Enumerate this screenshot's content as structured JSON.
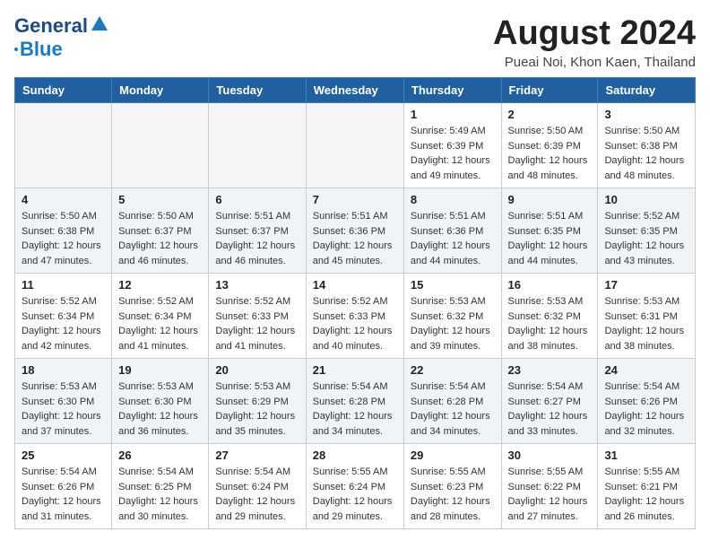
{
  "header": {
    "logo_line1": "General",
    "logo_line2": "Blue",
    "main_title": "August 2024",
    "subtitle": "Pueai Noi, Khon Kaen, Thailand"
  },
  "days_of_week": [
    "Sunday",
    "Monday",
    "Tuesday",
    "Wednesday",
    "Thursday",
    "Friday",
    "Saturday"
  ],
  "weeks": [
    [
      {
        "day": "",
        "info": ""
      },
      {
        "day": "",
        "info": ""
      },
      {
        "day": "",
        "info": ""
      },
      {
        "day": "",
        "info": ""
      },
      {
        "day": "1",
        "info": "Sunrise: 5:49 AM\nSunset: 6:39 PM\nDaylight: 12 hours\nand 49 minutes."
      },
      {
        "day": "2",
        "info": "Sunrise: 5:50 AM\nSunset: 6:39 PM\nDaylight: 12 hours\nand 48 minutes."
      },
      {
        "day": "3",
        "info": "Sunrise: 5:50 AM\nSunset: 6:38 PM\nDaylight: 12 hours\nand 48 minutes."
      }
    ],
    [
      {
        "day": "4",
        "info": "Sunrise: 5:50 AM\nSunset: 6:38 PM\nDaylight: 12 hours\nand 47 minutes."
      },
      {
        "day": "5",
        "info": "Sunrise: 5:50 AM\nSunset: 6:37 PM\nDaylight: 12 hours\nand 46 minutes."
      },
      {
        "day": "6",
        "info": "Sunrise: 5:51 AM\nSunset: 6:37 PM\nDaylight: 12 hours\nand 46 minutes."
      },
      {
        "day": "7",
        "info": "Sunrise: 5:51 AM\nSunset: 6:36 PM\nDaylight: 12 hours\nand 45 minutes."
      },
      {
        "day": "8",
        "info": "Sunrise: 5:51 AM\nSunset: 6:36 PM\nDaylight: 12 hours\nand 44 minutes."
      },
      {
        "day": "9",
        "info": "Sunrise: 5:51 AM\nSunset: 6:35 PM\nDaylight: 12 hours\nand 44 minutes."
      },
      {
        "day": "10",
        "info": "Sunrise: 5:52 AM\nSunset: 6:35 PM\nDaylight: 12 hours\nand 43 minutes."
      }
    ],
    [
      {
        "day": "11",
        "info": "Sunrise: 5:52 AM\nSunset: 6:34 PM\nDaylight: 12 hours\nand 42 minutes."
      },
      {
        "day": "12",
        "info": "Sunrise: 5:52 AM\nSunset: 6:34 PM\nDaylight: 12 hours\nand 41 minutes."
      },
      {
        "day": "13",
        "info": "Sunrise: 5:52 AM\nSunset: 6:33 PM\nDaylight: 12 hours\nand 41 minutes."
      },
      {
        "day": "14",
        "info": "Sunrise: 5:52 AM\nSunset: 6:33 PM\nDaylight: 12 hours\nand 40 minutes."
      },
      {
        "day": "15",
        "info": "Sunrise: 5:53 AM\nSunset: 6:32 PM\nDaylight: 12 hours\nand 39 minutes."
      },
      {
        "day": "16",
        "info": "Sunrise: 5:53 AM\nSunset: 6:32 PM\nDaylight: 12 hours\nand 38 minutes."
      },
      {
        "day": "17",
        "info": "Sunrise: 5:53 AM\nSunset: 6:31 PM\nDaylight: 12 hours\nand 38 minutes."
      }
    ],
    [
      {
        "day": "18",
        "info": "Sunrise: 5:53 AM\nSunset: 6:30 PM\nDaylight: 12 hours\nand 37 minutes."
      },
      {
        "day": "19",
        "info": "Sunrise: 5:53 AM\nSunset: 6:30 PM\nDaylight: 12 hours\nand 36 minutes."
      },
      {
        "day": "20",
        "info": "Sunrise: 5:53 AM\nSunset: 6:29 PM\nDaylight: 12 hours\nand 35 minutes."
      },
      {
        "day": "21",
        "info": "Sunrise: 5:54 AM\nSunset: 6:28 PM\nDaylight: 12 hours\nand 34 minutes."
      },
      {
        "day": "22",
        "info": "Sunrise: 5:54 AM\nSunset: 6:28 PM\nDaylight: 12 hours\nand 34 minutes."
      },
      {
        "day": "23",
        "info": "Sunrise: 5:54 AM\nSunset: 6:27 PM\nDaylight: 12 hours\nand 33 minutes."
      },
      {
        "day": "24",
        "info": "Sunrise: 5:54 AM\nSunset: 6:26 PM\nDaylight: 12 hours\nand 32 minutes."
      }
    ],
    [
      {
        "day": "25",
        "info": "Sunrise: 5:54 AM\nSunset: 6:26 PM\nDaylight: 12 hours\nand 31 minutes."
      },
      {
        "day": "26",
        "info": "Sunrise: 5:54 AM\nSunset: 6:25 PM\nDaylight: 12 hours\nand 30 minutes."
      },
      {
        "day": "27",
        "info": "Sunrise: 5:54 AM\nSunset: 6:24 PM\nDaylight: 12 hours\nand 29 minutes."
      },
      {
        "day": "28",
        "info": "Sunrise: 5:55 AM\nSunset: 6:24 PM\nDaylight: 12 hours\nand 29 minutes."
      },
      {
        "day": "29",
        "info": "Sunrise: 5:55 AM\nSunset: 6:23 PM\nDaylight: 12 hours\nand 28 minutes."
      },
      {
        "day": "30",
        "info": "Sunrise: 5:55 AM\nSunset: 6:22 PM\nDaylight: 12 hours\nand 27 minutes."
      },
      {
        "day": "31",
        "info": "Sunrise: 5:55 AM\nSunset: 6:21 PM\nDaylight: 12 hours\nand 26 minutes."
      }
    ]
  ]
}
